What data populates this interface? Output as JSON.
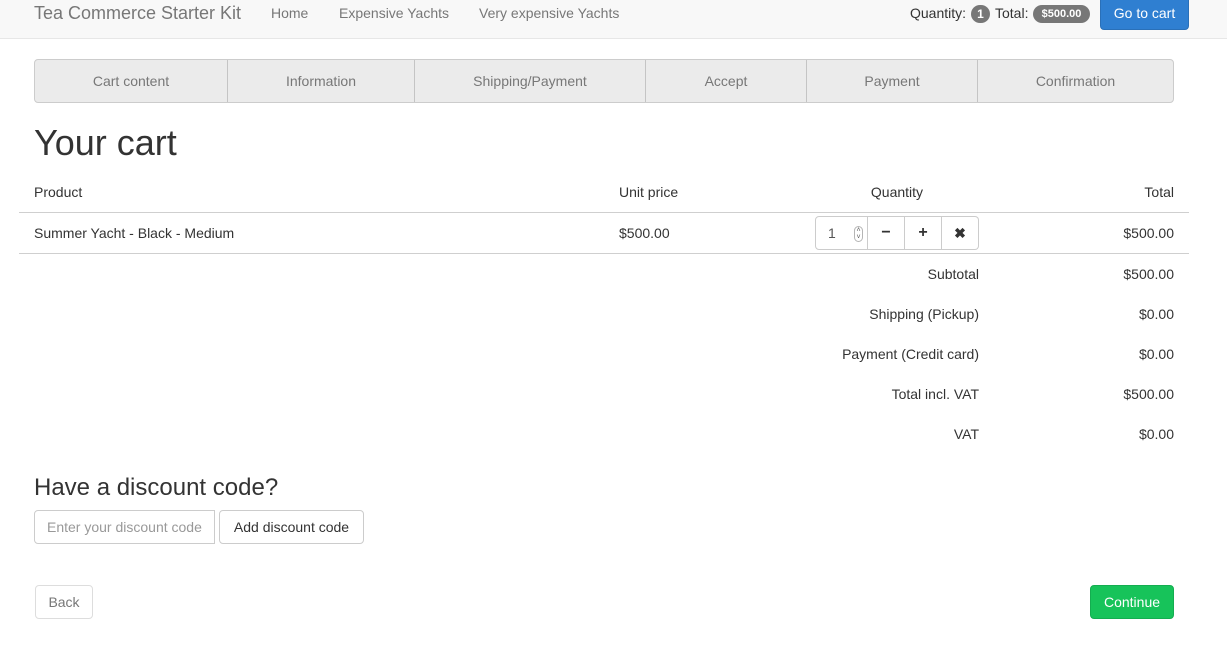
{
  "navbar": {
    "brand": "Tea Commerce Starter Kit",
    "links": [
      "Home",
      "Expensive Yachts",
      "Very expensive Yachts"
    ],
    "quantity_label": "Quantity:",
    "quantity_value": "1",
    "total_label": "Total:",
    "total_value": "$500.00",
    "cart_button": "Go to cart"
  },
  "steps": [
    "Cart content",
    "Information",
    "Shipping/Payment",
    "Accept",
    "Payment",
    "Confirmation"
  ],
  "page_title": "Your cart",
  "table": {
    "headers": {
      "product": "Product",
      "unit_price": "Unit price",
      "quantity": "Quantity",
      "total": "Total"
    },
    "rows": [
      {
        "product": "Summer Yacht - Black - Medium",
        "unit_price": "$500.00",
        "quantity": "1",
        "total": "$500.00"
      }
    ],
    "summary": [
      {
        "label": "Subtotal",
        "value": "$500.00"
      },
      {
        "label": "Shipping (Pickup)",
        "value": "$0.00"
      },
      {
        "label": "Payment (Credit card)",
        "value": "$0.00"
      },
      {
        "label": "Total incl. VAT",
        "value": "$500.00"
      },
      {
        "label": "VAT",
        "value": "$0.00"
      }
    ]
  },
  "discount": {
    "heading": "Have a discount code?",
    "placeholder": "Enter your discount code",
    "button": "Add discount code"
  },
  "actions": {
    "back": "Back",
    "continue": "Continue"
  },
  "icons": {
    "minus": "minus-icon",
    "plus": "plus-icon",
    "remove": "close-icon"
  },
  "colors": {
    "primary": "#2f7fd1",
    "success": "#17c35a",
    "badge": "#777777"
  }
}
